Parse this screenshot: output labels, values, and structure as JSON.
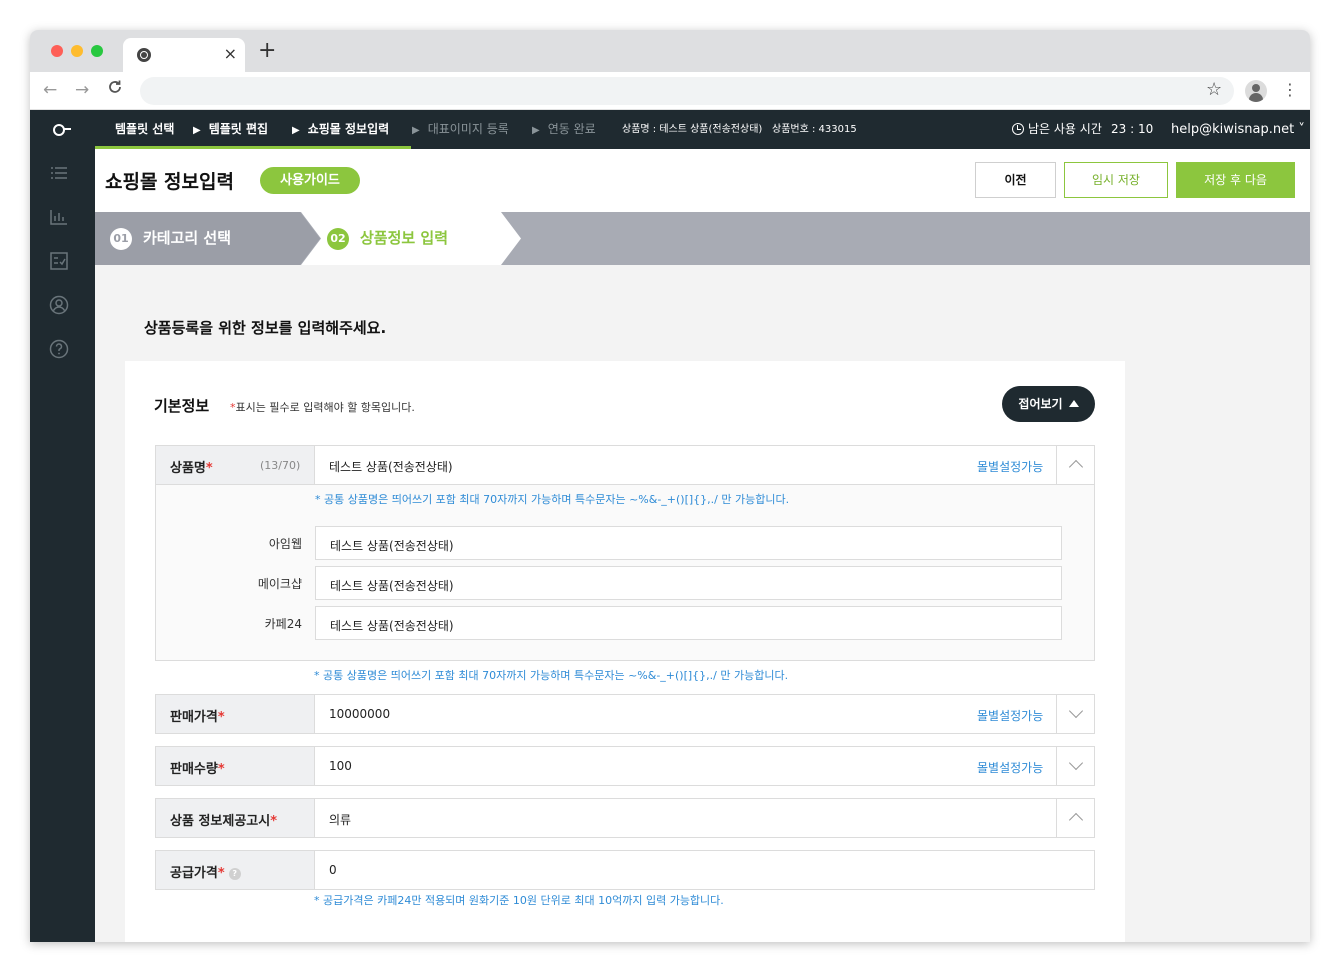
{
  "browser": {
    "tab_close": "×",
    "new_tab": "+",
    "back": "←",
    "forward": "→",
    "reload": "C",
    "bookmark": "☆",
    "menu": "⋮"
  },
  "topbar": {
    "steps": [
      {
        "label": "템플릿 선택",
        "state": "done"
      },
      {
        "label": "템플릿 편집",
        "state": "done"
      },
      {
        "label": "쇼핑몰 정보입력",
        "state": "active"
      },
      {
        "label": "대표이미지 등록",
        "state": "pending"
      },
      {
        "label": "연동 완료",
        "state": "pending"
      }
    ],
    "step_arrow": "▶",
    "product_name": "상품명 : 테스트 상품(전송전상태)",
    "product_number": "상품번호 : 433015",
    "remaining_label": "남은 사용 시간",
    "remaining_time": "23 : 10",
    "user_email": "help@kiwisnap.net ˅"
  },
  "header": {
    "title": "쇼핑몰 정보입력",
    "guide_button": "사용가이드",
    "prev_button": "이전",
    "temp_save_button": "임시 저장",
    "save_next_button": "저장 후 다음"
  },
  "stepbar": {
    "steps": [
      {
        "num": "01",
        "label": "카테고리 선택"
      },
      {
        "num": "02",
        "label": "상품정보 입력"
      }
    ]
  },
  "main": {
    "intro": "상품등록을 위한 정보를 입력해주세요.",
    "section_title": "기본정보",
    "required_star": "*",
    "required_note": "표시는 필수로 입력해야 할 항목입니다.",
    "fold_button": "접어보기",
    "fields": {
      "name": {
        "label": "상품명",
        "count": "(13/70)",
        "value": "테스트 상품(전송전상태)",
        "mall_link": "몰별설정가능",
        "hint": "* 공통 상품명은 띄어쓰기 포함 최대 70자까지 가능하며 특수문자는 ~%&-_+()[]{},./ 만 가능합니다.",
        "malls": [
          {
            "mall": "아임웹",
            "value": "테스트 상품(전송전상태)"
          },
          {
            "mall": "메이크샵",
            "value": "테스트 상품(전송전상태)"
          },
          {
            "mall": "카페24",
            "value": "테스트 상품(전송전상태)"
          }
        ],
        "hint_bottom": "* 공통 상품명은 띄어쓰기 포함 최대 70자까지 가능하며 특수문자는 ~%&-_+()[]{},./ 만 가능합니다."
      },
      "price": {
        "label": "판매가격",
        "value": "10000000",
        "mall_link": "몰별설정가능"
      },
      "quantity": {
        "label": "판매수량",
        "value": "100",
        "mall_link": "몰별설정가능"
      },
      "notice": {
        "label": "상품 정보제공고시",
        "value": "의류"
      },
      "supply": {
        "label": "공급가격",
        "help": "?",
        "value": "0",
        "hint": "* 공급가격은 카페24만 적용되며 원화기준 10원 단위로 최대 10억까지 입력 가능합니다."
      }
    }
  },
  "colors": {
    "accent": "#8cc63e",
    "dark_nav": "#1f2a30",
    "link_blue": "#2e8bd6",
    "required_red": "#e53935"
  },
  "icons": [
    "chrome-icon",
    "star-icon",
    "profile-icon",
    "clock-icon",
    "list-icon",
    "chart-icon",
    "checklist-icon",
    "user-icon",
    "help-icon"
  ]
}
